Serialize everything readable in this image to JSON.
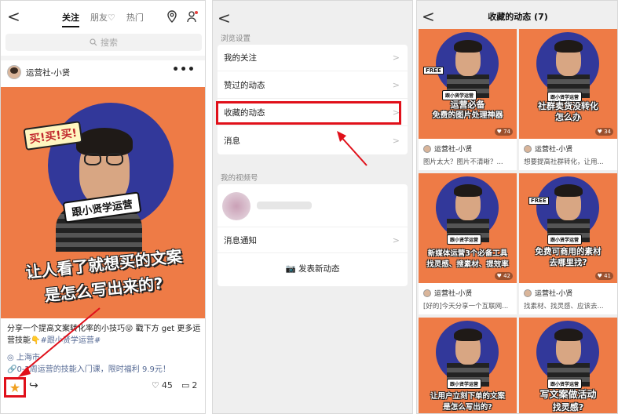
{
  "panel1": {
    "back": "<",
    "tabs": [
      {
        "label": "关注"
      },
      {
        "label": "朋友♡"
      },
      {
        "label": "热门"
      }
    ],
    "search_placeholder": "搜索",
    "author": "运营社-小贤",
    "more": "•••",
    "cover": {
      "exclaim": "买!买!买!",
      "tag": "跟小贤学运营",
      "line1": "让人看了就想买的文案",
      "line2": "是怎么写出来的?"
    },
    "description_text": "分享一个提高文案转化率的小技巧😜 戳下方 get 更多运营技能👇",
    "hashtag": "#跟小贤学运营#",
    "location": "上海市",
    "promo": "0-2周运营的技能入门课，限时福利 9.9元！",
    "likes": "45",
    "comments": "2"
  },
  "panel2": {
    "back": "<",
    "browse_label": "浏览设置",
    "rows": [
      {
        "label": "我的关注"
      },
      {
        "label": "赞过的动态"
      },
      {
        "label": "收藏的动态"
      },
      {
        "label": "消息"
      }
    ],
    "channel_label": "我的视频号",
    "notify_label": "消息通知",
    "publish_label": "发表新动态",
    "chev": ">"
  },
  "panel3": {
    "back": "<",
    "title": "收藏的动态 (7)",
    "tiles": [
      {
        "caption1": "运营必备",
        "caption2": "免费的图片处理神器",
        "likes": "♥ 74",
        "author": "运营社-小贤",
        "desc": "图片太大？图片不清晰？...",
        "free": "FREE",
        "tag": "跟小贤学运营"
      },
      {
        "caption1": "社群卖货没转化",
        "caption2": "怎么办",
        "likes": "♥ 34",
        "author": "运营社-小贤",
        "desc": "想要提高社群转化，让用...",
        "free": "",
        "tag": "跟小贤学运营"
      },
      {
        "caption1": "新媒体运营3个必备工具",
        "caption2": "找灵感、搜素材、提效率",
        "likes": "♥ 42",
        "author": "运营社-小贤",
        "desc": "[好的]今天分享一个互联网...",
        "free": "",
        "tag": "跟小贤学运营"
      },
      {
        "caption1": "免费可商用的素材",
        "caption2": "去哪里找?",
        "likes": "♥ 41",
        "author": "运营社-小贤",
        "desc": "找素材、找灵感、应该去...",
        "free": "FREE",
        "tag": "跟小贤学运营"
      },
      {
        "caption1": "让用户立刻下单的文案",
        "caption2": "是怎么写出的?",
        "likes": "",
        "author": "",
        "desc": "",
        "free": "",
        "tag": "跟小贤学运营"
      },
      {
        "caption1": "写文案做活动",
        "caption2": "找灵感?",
        "likes": "",
        "author": "",
        "desc": "",
        "free": "",
        "tag": "跟小贤学运营"
      }
    ]
  },
  "colors": {
    "accent_orange": "#ee7b46",
    "circle_blue": "#32389a",
    "highlight_red": "#e0101a",
    "link_blue": "#576b95"
  }
}
